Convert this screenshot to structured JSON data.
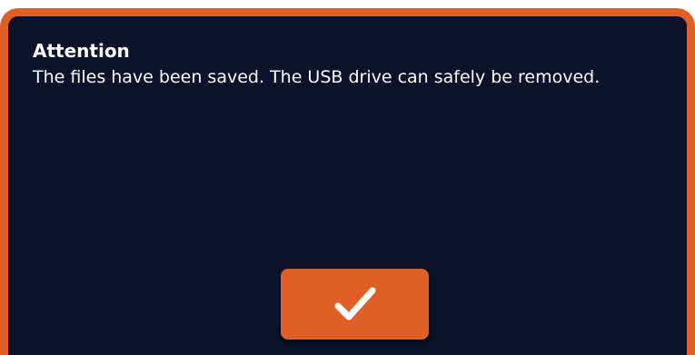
{
  "dialog": {
    "title": "Attention",
    "message": "The files have been saved. The USB drive can safely be removed.",
    "confirm_icon": "checkmark-icon"
  },
  "colors": {
    "background": "#0b1229",
    "accent": "#e05f26",
    "text": "#ffffff"
  }
}
